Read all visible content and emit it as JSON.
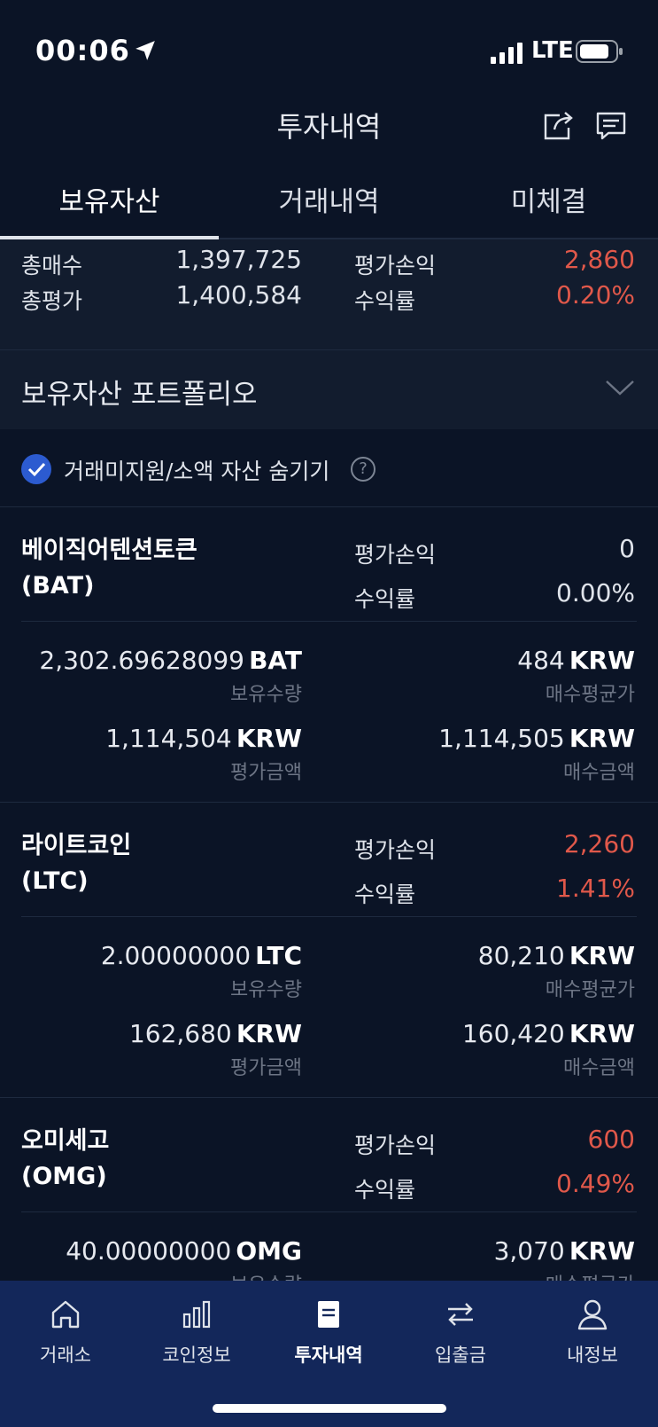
{
  "status_bar": {
    "time": "00:06",
    "network": "LTE"
  },
  "header": {
    "title": "투자내역"
  },
  "tabs": [
    {
      "label": "보유자산",
      "active": true
    },
    {
      "label": "거래내역",
      "active": false
    },
    {
      "label": "미체결",
      "active": false
    }
  ],
  "summary": {
    "total_buy_label": "총매수",
    "total_buy_value": "1,397,725",
    "total_eval_label": "총평가",
    "total_eval_value": "1,400,584",
    "pl_label": "평가손익",
    "pl_value": "2,860",
    "rate_label": "수익률",
    "rate_value": "0.20%"
  },
  "portfolio": {
    "label": "보유자산 포트폴리오"
  },
  "filter": {
    "label": "거래미지원/소액 자산 숨기기",
    "checked": true,
    "help": "?"
  },
  "assets": [
    {
      "name": "베이직어텐션토큰",
      "symbol": "(BAT)",
      "pl_label": "평가손익",
      "pl_value": "0",
      "rate_label": "수익률",
      "rate_value": "0.00%",
      "holding_num": "2,302.69628099",
      "holding_unit": "BAT",
      "holding_caption": "보유수량",
      "avg_num": "484",
      "avg_unit": "KRW",
      "avg_caption": "매수평균가",
      "eval_num": "1,114,504",
      "eval_unit": "KRW",
      "eval_caption": "평가금액",
      "buy_num": "1,114,505",
      "buy_unit": "KRW",
      "buy_caption": "매수금액"
    },
    {
      "name": "라이트코인",
      "symbol": "(LTC)",
      "pl_label": "평가손익",
      "pl_value": "2,260",
      "rate_label": "수익률",
      "rate_value": "1.41%",
      "holding_num": "2.00000000",
      "holding_unit": "LTC",
      "holding_caption": "보유수량",
      "avg_num": "80,210",
      "avg_unit": "KRW",
      "avg_caption": "매수평균가",
      "eval_num": "162,680",
      "eval_unit": "KRW",
      "eval_caption": "평가금액",
      "buy_num": "160,420",
      "buy_unit": "KRW",
      "buy_caption": "매수금액"
    },
    {
      "name": "오미세고",
      "symbol": "(OMG)",
      "pl_label": "평가손익",
      "pl_value": "600",
      "rate_label": "수익률",
      "rate_value": "0.49%",
      "holding_num": "40.00000000",
      "holding_unit": "OMG",
      "holding_caption": "보유수량",
      "avg_num": "3,070",
      "avg_unit": "KRW",
      "avg_caption": "매수평균가"
    }
  ],
  "nav": [
    {
      "label": "거래소",
      "icon": "home-icon"
    },
    {
      "label": "코인정보",
      "icon": "bar-chart-icon"
    },
    {
      "label": "투자내역",
      "icon": "document-icon",
      "active": true
    },
    {
      "label": "입출금",
      "icon": "transfer-icon"
    },
    {
      "label": "내정보",
      "icon": "person-icon"
    }
  ],
  "colors": {
    "background": "#0b1426",
    "loss_gain_red": "#e0584a",
    "nav_background": "#13275a",
    "checkbox_blue": "#2c5bd0"
  }
}
